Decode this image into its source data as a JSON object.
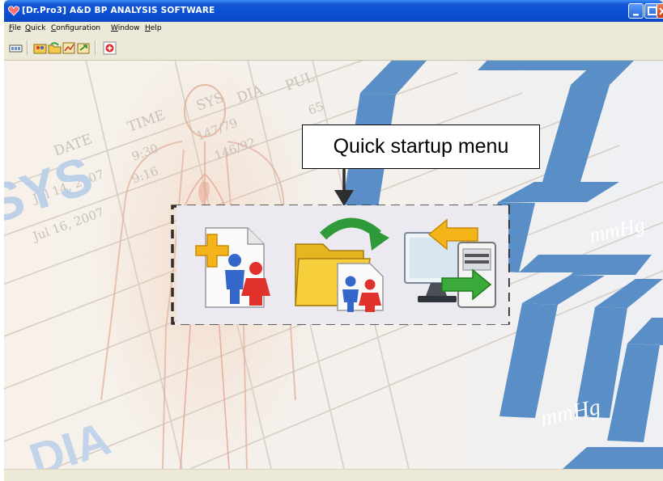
{
  "window": {
    "title": "[Dr.Pro3] A&D BP ANALYSIS SOFTWARE"
  },
  "menu": {
    "items": [
      {
        "accel": "F",
        "rest": "ile"
      },
      {
        "accel": "Q",
        "rest": "uick"
      },
      {
        "accel": "C",
        "rest": "onfiguration"
      },
      {
        "accel": "W",
        "rest": "indow"
      },
      {
        "accel": "H",
        "rest": "elp"
      }
    ]
  },
  "toolbar": {
    "icons": [
      "measurement-icon",
      "patient-folder-icon",
      "open-folder-icon",
      "chart-edit-icon",
      "export-icon",
      "add-record-icon"
    ]
  },
  "background": {
    "table_headers": [
      "DATE",
      "TIME",
      "SYS",
      "DIA",
      "PUL"
    ],
    "rows": [
      [
        "Jul 14, 2007",
        "9:30",
        "147/79",
        "65"
      ],
      [
        "Jul 16, 2007",
        "9:16",
        "146/92",
        ""
      ]
    ],
    "labels": {
      "sys": "SYS",
      "dia": "DIA"
    },
    "units": [
      "mmHg",
      "mmHg"
    ]
  },
  "annotation": {
    "callout": "Quick startup menu"
  },
  "quick_startup": {
    "buttons": [
      {
        "name": "new-patient-button",
        "icon": "new-patient-icon"
      },
      {
        "name": "open-patient-button",
        "icon": "open-patient-icon"
      },
      {
        "name": "data-transfer-button",
        "icon": "data-transfer-icon"
      }
    ]
  },
  "colors": {
    "titlebar": "#0a4fd2",
    "chrome": "#ece9d8",
    "digit_blue": "#4d86c4",
    "grid_line": "#d9d3ca",
    "callout_border": "#000000"
  }
}
